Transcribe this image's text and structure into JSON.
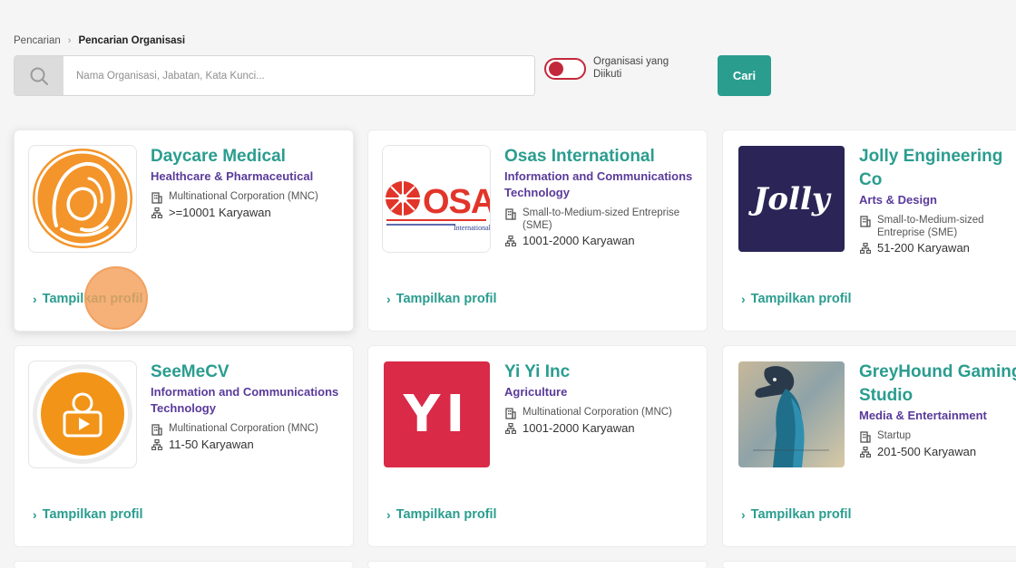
{
  "breadcrumb": {
    "items": [
      "Pencarian",
      "Pencarian Organisasi"
    ],
    "separator": "›"
  },
  "search": {
    "placeholder": "Nama Organisasi, Jabatan, Kata Kunci...",
    "value": ""
  },
  "toggle": {
    "label": "Organisasi yang Diikuti",
    "checked": false
  },
  "search_button": {
    "label": "Cari"
  },
  "colors": {
    "accent": "#2a9d8f",
    "industry": "#5a3a9a",
    "toggle": "#c3283a"
  },
  "cards": [
    {
      "name": "Daycare Medical",
      "industry": "Healthcare & Pharmaceutical",
      "type": "Multinational Corporation (MNC)",
      "employees": ">=10001 Karyawan",
      "link": "Tampilkan profil",
      "logo": "mother-child-logo"
    },
    {
      "name": "Osas International",
      "industry": "Information and Communications Technology",
      "type": "Small-to-Medium-sized Entreprise (SME)",
      "employees": "1001-2000 Karyawan",
      "link": "Tampilkan profil",
      "logo": "osa-international-logo",
      "logo_text": "OSA",
      "logo_subtext": "International"
    },
    {
      "name": "Jolly Engineering Co",
      "industry": "Arts & Design",
      "type": "Small-to-Medium-sized Entreprise (SME)",
      "employees": "51-200 Karyawan",
      "link": "Tampilkan profil",
      "logo": "jolly-logo",
      "logo_text": "Jolly"
    },
    {
      "name": "SeeMeCV",
      "industry": "Information and Communications Technology",
      "type": "Multinational Corporation (MNC)",
      "employees": "11-50 Karyawan",
      "link": "Tampilkan profil",
      "logo": "seemecv-logo"
    },
    {
      "name": "Yi Yi Inc",
      "industry": "Agriculture",
      "type": "Multinational Corporation (MNC)",
      "employees": "1001-2000 Karyawan",
      "link": "Tampilkan profil",
      "logo": "yi-logo",
      "logo_text": "YI"
    },
    {
      "name": "GreyHound Gaming Studio",
      "industry": "Media & Entertainment",
      "type": "Startup",
      "employees": "201-500 Karyawan",
      "link": "Tampilkan profil",
      "logo": "greyhound-logo"
    }
  ]
}
